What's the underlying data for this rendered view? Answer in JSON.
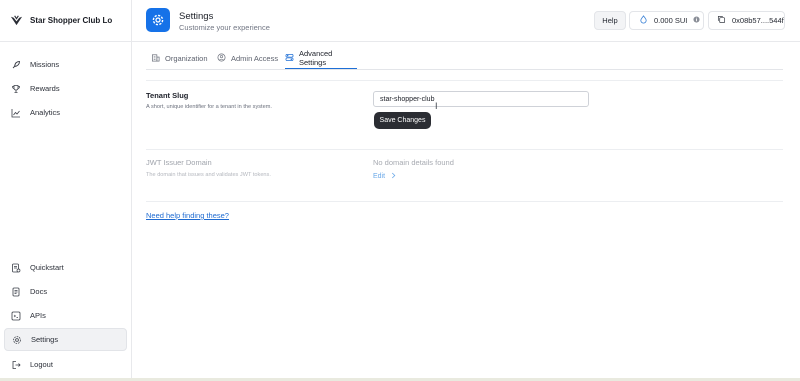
{
  "brand": {
    "name": "Star Shopper Club Lo"
  },
  "sidebar": {
    "top_items": [
      {
        "label": "Missions",
        "icon": "rocket-icon"
      },
      {
        "label": "Rewards",
        "icon": "trophy-icon"
      },
      {
        "label": "Analytics",
        "icon": "chart-line-icon"
      }
    ],
    "bottom_items": [
      {
        "label": "Quickstart",
        "icon": "quickstart-doc-icon"
      },
      {
        "label": "Docs",
        "icon": "docs-icon"
      },
      {
        "label": "APIs",
        "icon": "api-icon"
      },
      {
        "label": "Settings",
        "icon": "gear-icon",
        "active": true
      },
      {
        "label": "Logout",
        "icon": "logout-icon"
      }
    ]
  },
  "header": {
    "title": "Settings",
    "subtitle": "Customize your experience",
    "help_label": "Help",
    "balance": "0.000 SUI",
    "wallet": "0x08b57....544f"
  },
  "tabs": [
    {
      "label": "Organization",
      "icon": "building-icon",
      "active": false
    },
    {
      "label": "Admin Access",
      "icon": "user-circle-icon",
      "active": false
    },
    {
      "label": "Advanced Settings",
      "icon": "sliders-icon",
      "active": true
    }
  ],
  "tenant_slug": {
    "label": "Tenant Slug",
    "description": "A short, unique identifier for a tenant in the system.",
    "value": "star-shopper-club",
    "save_label": "Save Changes"
  },
  "jwt": {
    "label": "JWT Issuer Domain",
    "description": "The domain that issues and validates JWT tokens.",
    "value": "No domain details found",
    "edit_label": "Edit"
  },
  "help_link": "Need help finding these?",
  "colors": {
    "accent": "#1672e8",
    "link": "#1f6bd1",
    "button": "#2b2d33"
  }
}
